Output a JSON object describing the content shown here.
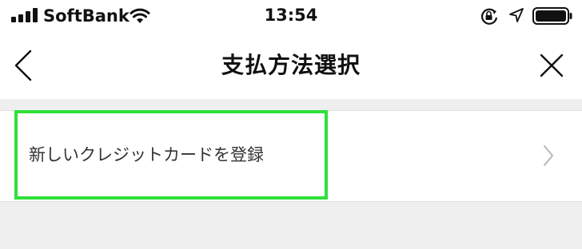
{
  "status_bar": {
    "carrier": "SoftBank",
    "time": "13:54",
    "icons": {
      "signal": "cellular-signal-icon",
      "wifi": "wifi-icon",
      "rotation_lock": "rotation-lock-icon",
      "location": "location-arrow-icon",
      "battery": "battery-icon"
    },
    "signal_bars": 4,
    "battery_level": 1.0
  },
  "nav": {
    "title": "支払方法選択",
    "back_icon": "chevron-left-icon",
    "close_icon": "close-icon"
  },
  "list": {
    "items": [
      {
        "label": "新しいクレジットカードを登録",
        "icon": "chevron-right-icon",
        "highlighted": true
      }
    ]
  },
  "colors": {
    "background": "#efefef",
    "surface": "#ffffff",
    "highlight": "#2fe03a",
    "chevron": "#b8b8b8"
  }
}
